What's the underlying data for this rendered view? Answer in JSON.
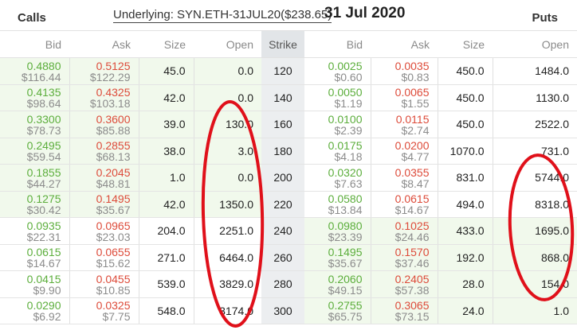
{
  "header": {
    "calls_label": "Calls",
    "underlying": "Underlying: SYN.ETH-31JUL20($238.65)",
    "date": "31 Jul 2020",
    "puts_label": "Puts"
  },
  "columns": {
    "calls": [
      "Bid",
      "Ask",
      "Size",
      "Open"
    ],
    "strike": "Strike",
    "puts": [
      "Bid",
      "Ask",
      "Size",
      "Open"
    ]
  },
  "colors": {
    "bid": "#5cae3c",
    "ask": "#dd4b3a",
    "annotation": "#e0101a",
    "itm_bg": "#f1f9ec",
    "strike_bg": "#eceef0"
  },
  "rows": [
    {
      "strike": "120",
      "c_bid": "0.4880",
      "c_bid_usd": "$116.44",
      "c_ask": "0.5125",
      "c_ask_usd": "$122.29",
      "c_size": "45.0",
      "c_open": "0.0",
      "p_bid": "0.0025",
      "p_bid_usd": "$0.60",
      "p_ask": "0.0035",
      "p_ask_usd": "$0.83",
      "p_size": "450.0",
      "p_open": "1484.0"
    },
    {
      "strike": "140",
      "c_bid": "0.4135",
      "c_bid_usd": "$98.64",
      "c_ask": "0.4325",
      "c_ask_usd": "$103.18",
      "c_size": "42.0",
      "c_open": "0.0",
      "p_bid": "0.0050",
      "p_bid_usd": "$1.19",
      "p_ask": "0.0065",
      "p_ask_usd": "$1.55",
      "p_size": "450.0",
      "p_open": "1130.0"
    },
    {
      "strike": "160",
      "c_bid": "0.3300",
      "c_bid_usd": "$78.73",
      "c_ask": "0.3600",
      "c_ask_usd": "$85.88",
      "c_size": "39.0",
      "c_open": "130.0",
      "p_bid": "0.0100",
      "p_bid_usd": "$2.39",
      "p_ask": "0.0115",
      "p_ask_usd": "$2.74",
      "p_size": "450.0",
      "p_open": "2522.0"
    },
    {
      "strike": "180",
      "c_bid": "0.2495",
      "c_bid_usd": "$59.54",
      "c_ask": "0.2855",
      "c_ask_usd": "$68.13",
      "c_size": "38.0",
      "c_open": "3.0",
      "p_bid": "0.0175",
      "p_bid_usd": "$4.18",
      "p_ask": "0.0200",
      "p_ask_usd": "$4.77",
      "p_size": "1070.0",
      "p_open": "731.0"
    },
    {
      "strike": "200",
      "c_bid": "0.1855",
      "c_bid_usd": "$44.27",
      "c_ask": "0.2045",
      "c_ask_usd": "$48.81",
      "c_size": "1.0",
      "c_open": "0.0",
      "p_bid": "0.0320",
      "p_bid_usd": "$7.63",
      "p_ask": "0.0355",
      "p_ask_usd": "$8.47",
      "p_size": "831.0",
      "p_open": "5744.0"
    },
    {
      "strike": "220",
      "c_bid": "0.1275",
      "c_bid_usd": "$30.42",
      "c_ask": "0.1495",
      "c_ask_usd": "$35.67",
      "c_size": "42.0",
      "c_open": "1350.0",
      "p_bid": "0.0580",
      "p_bid_usd": "$13.84",
      "p_ask": "0.0615",
      "p_ask_usd": "$14.67",
      "p_size": "494.0",
      "p_open": "8318.0"
    },
    {
      "strike": "240",
      "c_bid": "0.0935",
      "c_bid_usd": "$22.31",
      "c_ask": "0.0965",
      "c_ask_usd": "$23.03",
      "c_size": "204.0",
      "c_open": "2251.0",
      "p_bid": "0.0980",
      "p_bid_usd": "$23.39",
      "p_ask": "0.1025",
      "p_ask_usd": "$24.46",
      "p_size": "433.0",
      "p_open": "1695.0"
    },
    {
      "strike": "260",
      "c_bid": "0.0615",
      "c_bid_usd": "$14.67",
      "c_ask": "0.0655",
      "c_ask_usd": "$15.62",
      "c_size": "271.0",
      "c_open": "6464.0",
      "p_bid": "0.1495",
      "p_bid_usd": "$35.67",
      "p_ask": "0.1570",
      "p_ask_usd": "$37.46",
      "p_size": "192.0",
      "p_open": "868.0"
    },
    {
      "strike": "280",
      "c_bid": "0.0415",
      "c_bid_usd": "$9.90",
      "c_ask": "0.0455",
      "c_ask_usd": "$10.85",
      "c_size": "539.0",
      "c_open": "3829.0",
      "p_bid": "0.2060",
      "p_bid_usd": "$49.15",
      "p_ask": "0.2405",
      "p_ask_usd": "$57.38",
      "p_size": "28.0",
      "p_open": "154.0"
    },
    {
      "strike": "300",
      "c_bid": "0.0290",
      "c_bid_usd": "$6.92",
      "c_ask": "0.0325",
      "c_ask_usd": "$7.75",
      "c_size": "548.0",
      "c_open": "3174.0",
      "p_bid": "0.2755",
      "p_bid_usd": "$65.75",
      "p_ask": "0.3065",
      "p_ask_usd": "$73.15",
      "p_size": "24.0",
      "p_open": "1.0"
    }
  ]
}
